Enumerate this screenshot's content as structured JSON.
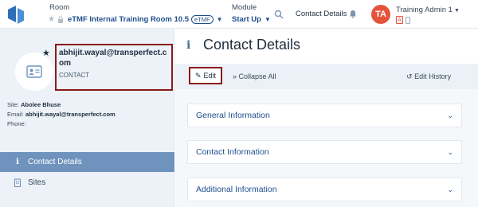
{
  "header": {
    "room_label": "Room",
    "room_name": "eTMF Internal Training Room 10.5",
    "room_badge": "eTMF",
    "module_label": "Module",
    "module_value": "Start Up",
    "breadcrumb": "Contact Details",
    "user_initials": "TA",
    "user_name": "Training Admin 1",
    "user_badge": "A",
    "avatar_color": "#e5533c"
  },
  "contact": {
    "email": "abhijit.wayal@transperfect.com",
    "type": "CONTACT",
    "site_label": "Site:",
    "site_value": "Abolee Bhuse",
    "email_label": "Email:",
    "email_value": "abhijit.wayal@transperfect.com",
    "phone_label": "Phone:",
    "phone_value": ""
  },
  "sidebar": {
    "items": [
      {
        "label": "Contact Details",
        "icon": "info-icon",
        "active": true
      },
      {
        "label": "Sites",
        "icon": "building-icon",
        "active": false
      }
    ]
  },
  "main": {
    "title": "Contact Details",
    "toolbar": {
      "edit": "Edit",
      "collapse_all": "Collapse All",
      "edit_history": "Edit History"
    },
    "panels": [
      {
        "label": "General Information"
      },
      {
        "label": "Contact Information"
      },
      {
        "label": "Additional Information"
      }
    ]
  },
  "colors": {
    "accent": "#1f4e8c",
    "nav_active": "#6f93bd",
    "highlight_border": "#8a1a1a"
  }
}
